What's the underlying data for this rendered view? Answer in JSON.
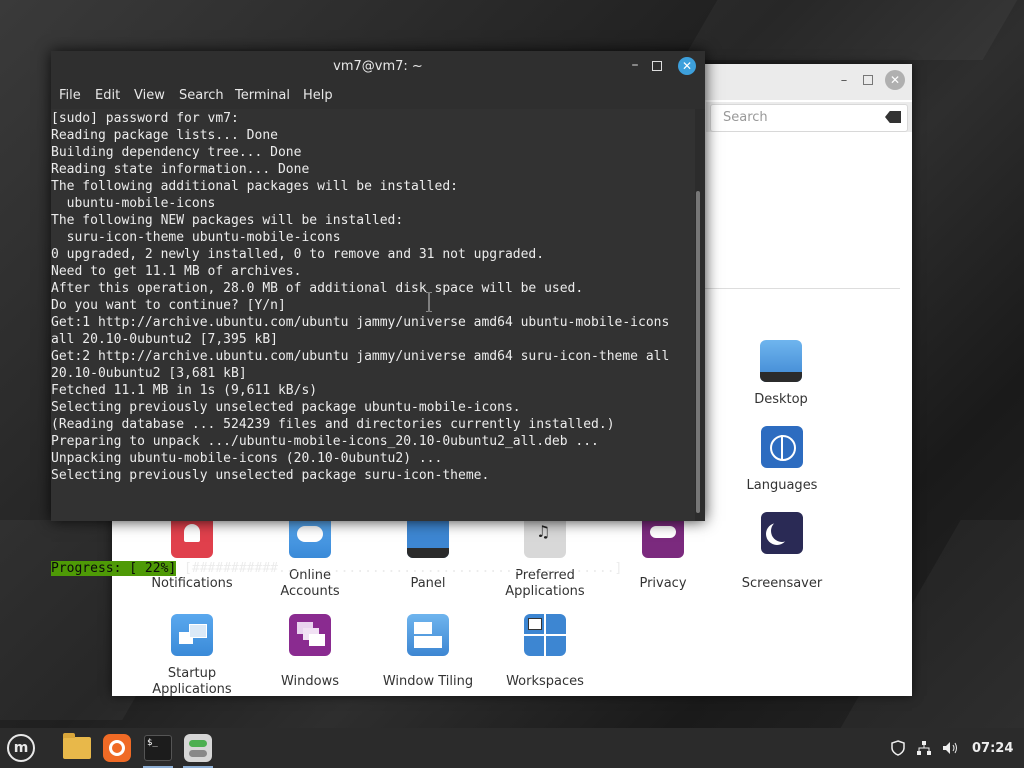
{
  "terminal": {
    "title": "vm7@vm7: ~",
    "menu": [
      "File",
      "Edit",
      "View",
      "Search",
      "Terminal",
      "Help"
    ],
    "lines": [
      "[sudo] password for vm7:",
      "Reading package lists... Done",
      "Building dependency tree... Done",
      "Reading state information... Done",
      "The following additional packages will be installed:",
      "  ubuntu-mobile-icons",
      "The following NEW packages will be installed:",
      "  suru-icon-theme ubuntu-mobile-icons",
      "0 upgraded, 2 newly installed, 0 to remove and 31 not upgraded.",
      "Need to get 11.1 MB of archives.",
      "After this operation, 28.0 MB of additional disk space will be used.",
      "Do you want to continue? [Y/n]",
      "Get:1 http://archive.ubuntu.com/ubuntu jammy/universe amd64 ubuntu-mobile-icons",
      "all 20.10-0ubuntu2 [7,395 kB]",
      "Get:2 http://archive.ubuntu.com/ubuntu jammy/universe amd64 suru-icon-theme all",
      "20.10-0ubuntu2 [3,681 kB]",
      "Fetched 11.1 MB in 1s (9,611 kB/s)",
      "Selecting previously unselected package ubuntu-mobile-icons.",
      "(Reading database ... 524239 files and directories currently installed.)",
      "Preparing to unpack .../ubuntu-mobile-icons_20.10-0ubuntu2_all.deb ...",
      "Unpacking ubuntu-mobile-icons (20.10-0ubuntu2) ...",
      "Selecting previously unselected package suru-icon-theme."
    ],
    "progress_label": "Progress: [ 22%]",
    "progress_bar": " [###########...........................................]",
    "progress_fraction": 0.22
  },
  "settings": {
    "search_placeholder": "Search",
    "items": {
      "desktop": "Desktop",
      "languages": "Languages",
      "notifications": "Notifications",
      "online_accounts": "Online\nAccounts",
      "panel": "Panel",
      "preferred_applications": "Preferred\nApplications",
      "privacy": "Privacy",
      "screensaver": "Screensaver",
      "startup_applications": "Startup\nApplications",
      "windows": "Windows",
      "window_tiling": "Window Tiling",
      "workspaces": "Workspaces"
    }
  },
  "taskbar": {
    "clock": "07:24"
  },
  "colors": {
    "terminal_bg": "#323232",
    "progress_green": "#4e9a06",
    "close_blue": "#3da0dc",
    "taskbar": "#2b2b2b"
  }
}
